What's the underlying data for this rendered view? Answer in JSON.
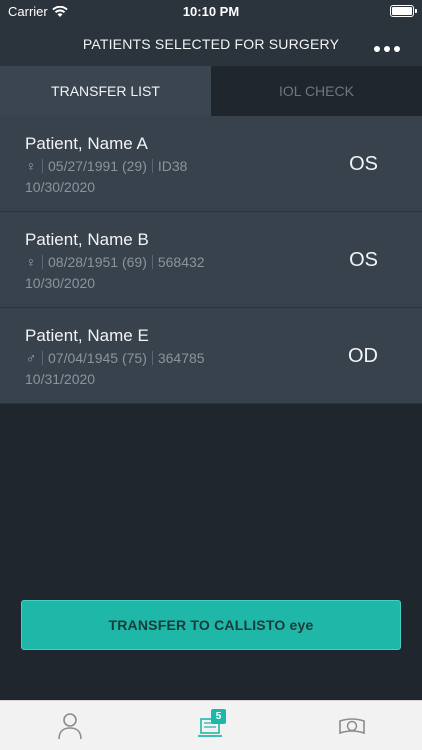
{
  "status_bar": {
    "carrier": "Carrier",
    "time": "10:10 PM"
  },
  "header": {
    "title": "PATIENTS SELECTED FOR SURGERY",
    "more_icon": "more-dots-icon"
  },
  "tabs": [
    {
      "label": "TRANSFER LIST",
      "active": true
    },
    {
      "label": "IOL CHECK",
      "active": false
    }
  ],
  "patients": [
    {
      "name": "Patient, Name A",
      "gender_symbol": "♀",
      "dob": "05/27/1991 (29)",
      "id": "ID38",
      "surgery_date": "10/30/2020",
      "eye": "OS"
    },
    {
      "name": "Patient, Name B",
      "gender_symbol": "♀",
      "dob": "08/28/1951 (69)",
      "id": "568432",
      "surgery_date": "10/30/2020",
      "eye": "OS"
    },
    {
      "name": "Patient, Name E",
      "gender_symbol": "♂",
      "dob": "07/04/1945 (75)",
      "id": "364785",
      "surgery_date": "10/31/2020",
      "eye": "OD"
    }
  ],
  "action": {
    "transfer_label": "TRANSFER TO CALLISTO eye"
  },
  "tab_bar": {
    "items": [
      {
        "icon": "person-icon"
      },
      {
        "icon": "transfer-list-icon",
        "badge": "5"
      },
      {
        "icon": "lens-icon"
      }
    ]
  },
  "colors": {
    "accent": "#1fb8a8",
    "background": "#1f262d",
    "row": "#38424c"
  }
}
